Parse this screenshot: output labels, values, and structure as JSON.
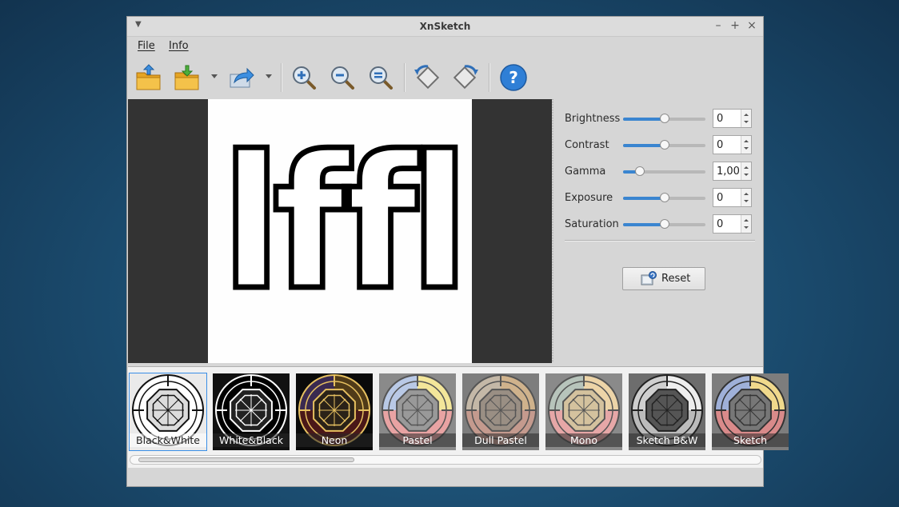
{
  "window": {
    "title": "XnSketch",
    "controls": {
      "minimize": "–",
      "maximize": "+",
      "close": "×"
    }
  },
  "menubar": {
    "items": [
      {
        "label": "File"
      },
      {
        "label": "Info"
      }
    ]
  },
  "toolbar": {
    "icons": [
      "open-folder-icon",
      "save-folder-icon",
      "share-icon",
      "zoom-in-icon",
      "zoom-out-icon",
      "zoom-fit-icon",
      "rotate-left-icon",
      "rotate-right-icon",
      "help-icon"
    ]
  },
  "controls": {
    "brightness": {
      "label": "Brightness",
      "value": "0",
      "level": 0.5
    },
    "contrast": {
      "label": "Contrast",
      "value": "0",
      "level": 0.5
    },
    "gamma": {
      "label": "Gamma",
      "value": "1,00",
      "level": 0.2
    },
    "exposure": {
      "label": "Exposure",
      "value": "0",
      "level": 0.5
    },
    "saturation": {
      "label": "Saturation",
      "value": "0",
      "level": 0.5
    },
    "reset_label": "Reset"
  },
  "preview": {
    "text": "lffl"
  },
  "filters": {
    "items": [
      {
        "label": "Black&White",
        "selected": true
      },
      {
        "label": "White&Black",
        "selected": false
      },
      {
        "label": "Neon",
        "selected": false
      },
      {
        "label": "Pastel",
        "selected": false
      },
      {
        "label": "Dull Pastel",
        "selected": false
      },
      {
        "label": "Mono",
        "selected": false
      },
      {
        "label": "Sketch B&W",
        "selected": false
      },
      {
        "label": "Sketch",
        "selected": false
      }
    ]
  },
  "colors": {
    "accent": "#3a85d0",
    "selection": "#3a8ee6"
  }
}
